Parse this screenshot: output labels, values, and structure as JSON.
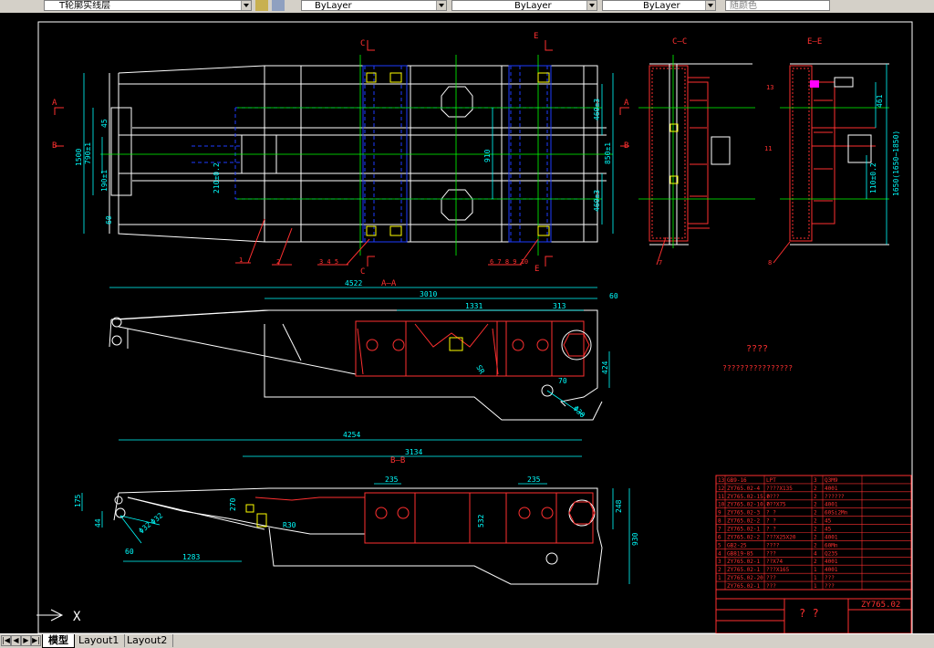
{
  "toolbar": {
    "layer_name": "T轮廓实线层",
    "color_control": "ByLayer",
    "linetype_control": "ByLayer",
    "lineweight_control": "ByLayer",
    "plotstyle_control": "随颜色"
  },
  "tabs": {
    "model": "模型",
    "layout1": "Layout1",
    "layout2": "Layout2"
  },
  "ucs": {
    "x_label": "X"
  },
  "drawing": {
    "section_c": "C",
    "section_e": "E",
    "section_a": "A",
    "section_b": "B",
    "view_cc": "C—C",
    "view_ee": "E—E",
    "view_aa": "A—A",
    "view_bb": "B—B",
    "dims_plan": [
      "1500",
      "790±1",
      "190±1",
      "60",
      "45",
      "210±0.2",
      "910",
      "850±1",
      "460±3",
      "460±3"
    ],
    "dims_aa": [
      "4522",
      "3010",
      "60",
      "1331",
      "313",
      "424",
      "70",
      "Φ30",
      "SR"
    ],
    "dims_bb": [
      "4254",
      "3134",
      "235",
      "235",
      "175",
      "44",
      "270",
      "60",
      "1283",
      "248",
      "930",
      "R30",
      "Φ32",
      "Φ32",
      "532"
    ],
    "dims_ee": [
      "461",
      "1650(1650~1850)",
      "110±0.2",
      "13",
      "11"
    ],
    "balloons": [
      "1",
      "2",
      "3  4  5",
      "6 7 8 9 10",
      "7",
      "8",
      "9",
      "12",
      "10"
    ],
    "note_title": "????",
    "note_text": "????????????????",
    "title_block_code": "ZY765.02",
    "title_block_name": "?  ?",
    "bom_rows": [
      [
        "13",
        "GB9-16",
        "LPT",
        "3",
        "Q3M9"
      ],
      [
        "12",
        "ZY765.02-4",
        "????X135",
        "2",
        "4001"
      ],
      [
        "11",
        "ZY765.02-15.0",
        "????",
        "2",
        "??????"
      ],
      [
        "10",
        "ZY765.02-10.0",
        "???X75",
        "2",
        "4001"
      ],
      [
        "9",
        "ZY765.02-3",
        "?  ?",
        "2",
        "60Si2Mn"
      ],
      [
        "8",
        "ZY765.02-2",
        "?  ?",
        "2",
        "45"
      ],
      [
        "7",
        "ZY765.02-1",
        "?  ?",
        "2",
        "45"
      ],
      [
        "6",
        "ZY765.02-2",
        "???X25X20",
        "2",
        "4001"
      ],
      [
        "5",
        "GB2-25",
        "????",
        "2",
        "60Mn"
      ],
      [
        "4",
        "GB819-85",
        "???",
        "4",
        "Q235"
      ],
      [
        "3",
        "ZY765.02-1",
        "??X74",
        "2",
        "4001"
      ],
      [
        "2",
        "ZY765.02-1",
        "???X165",
        "1",
        "4001"
      ],
      [
        "1",
        "ZY765.02-20",
        "???",
        "1",
        "???"
      ],
      [
        "",
        "ZY765.02-1",
        "???",
        "1",
        "???"
      ]
    ]
  },
  "colors": {
    "background": "#000000",
    "outline": "#ffffff",
    "dimension": "#00ffff",
    "hidden": "#0000ff",
    "center": "#00ff00",
    "section": "#ff3030",
    "hatch": "#ff6060",
    "balloon": "#ff0000",
    "highlight": "#ffff00",
    "magenta": "#ff00ff"
  }
}
